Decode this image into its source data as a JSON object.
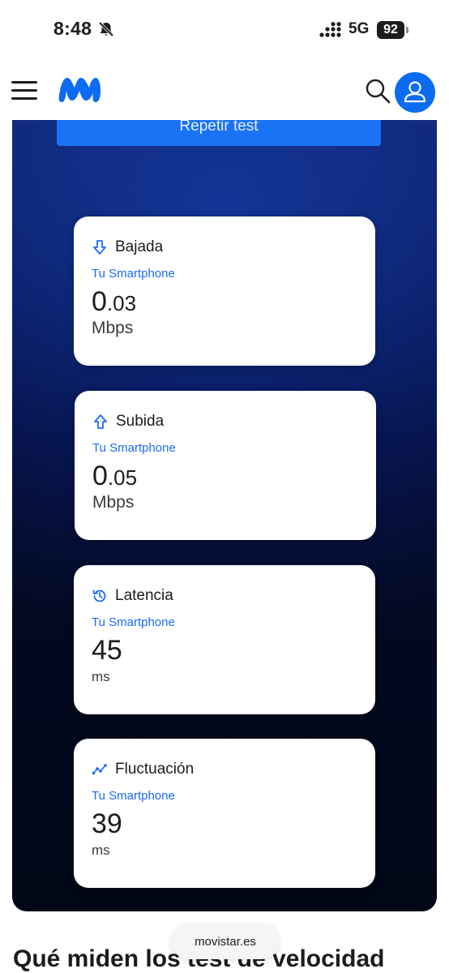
{
  "status_bar": {
    "time": "8:48",
    "network": "5G",
    "battery": "92"
  },
  "header": {
    "menu_icon": "hamburger-icon",
    "logo": "movistar-m-logo",
    "search_icon": "search-icon",
    "account_icon": "user-icon",
    "brand_color": "#0b6cf2"
  },
  "test": {
    "repeat_label": "Repetir test",
    "cards": [
      {
        "icon": "arrow-down-icon",
        "title": "Bajada",
        "source": "Tu Smartphone",
        "value_int": "0",
        "value_dec": ".03",
        "unit": "Mbps"
      },
      {
        "icon": "arrow-up-icon",
        "title": "Subida",
        "source": "Tu Smartphone",
        "value_int": "0",
        "value_dec": ".05",
        "unit": "Mbps"
      },
      {
        "icon": "history-icon",
        "title": "Latencia",
        "source": "Tu Smartphone",
        "value_int": "45",
        "value_dec": "",
        "unit": "ms"
      },
      {
        "icon": "chart-line-icon",
        "title": "Fluctuación",
        "source": "Tu Smartphone",
        "value_int": "39",
        "value_dec": "",
        "unit": "ms"
      }
    ]
  },
  "section": {
    "title": "Qué miden los test de velocidad"
  },
  "browser": {
    "url": "movistar.es"
  }
}
